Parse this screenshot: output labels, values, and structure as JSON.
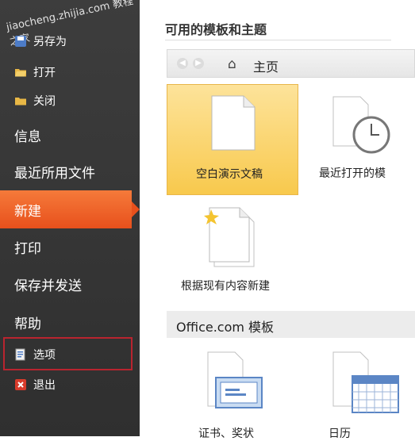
{
  "watermark": "jiaocheng.zhijia.com 教程之家",
  "sidebar": {
    "saveas": "另存为",
    "open": "打开",
    "close": "关闭",
    "info": "信息",
    "recent": "最近所用文件",
    "new": "新建",
    "print": "打印",
    "save_send": "保存并发送",
    "help": "帮助",
    "options": "选项",
    "exit": "退出"
  },
  "main": {
    "available_title": "可用的模板和主题",
    "home": "主页",
    "templates": [
      {
        "label": "空白演示文稿"
      },
      {
        "label": "最近打开的模"
      },
      {
        "label": "根据现有内容新建"
      }
    ],
    "office_title": "Office.com 模板",
    "office_templates": [
      {
        "label": "证书、奖状"
      },
      {
        "label": "日历"
      }
    ]
  },
  "colors": {
    "sidebar_bg": "#333333",
    "active_orange": "#e8501c",
    "selected_tile": "#f8c94d",
    "highlight_box": "#b9242f"
  }
}
